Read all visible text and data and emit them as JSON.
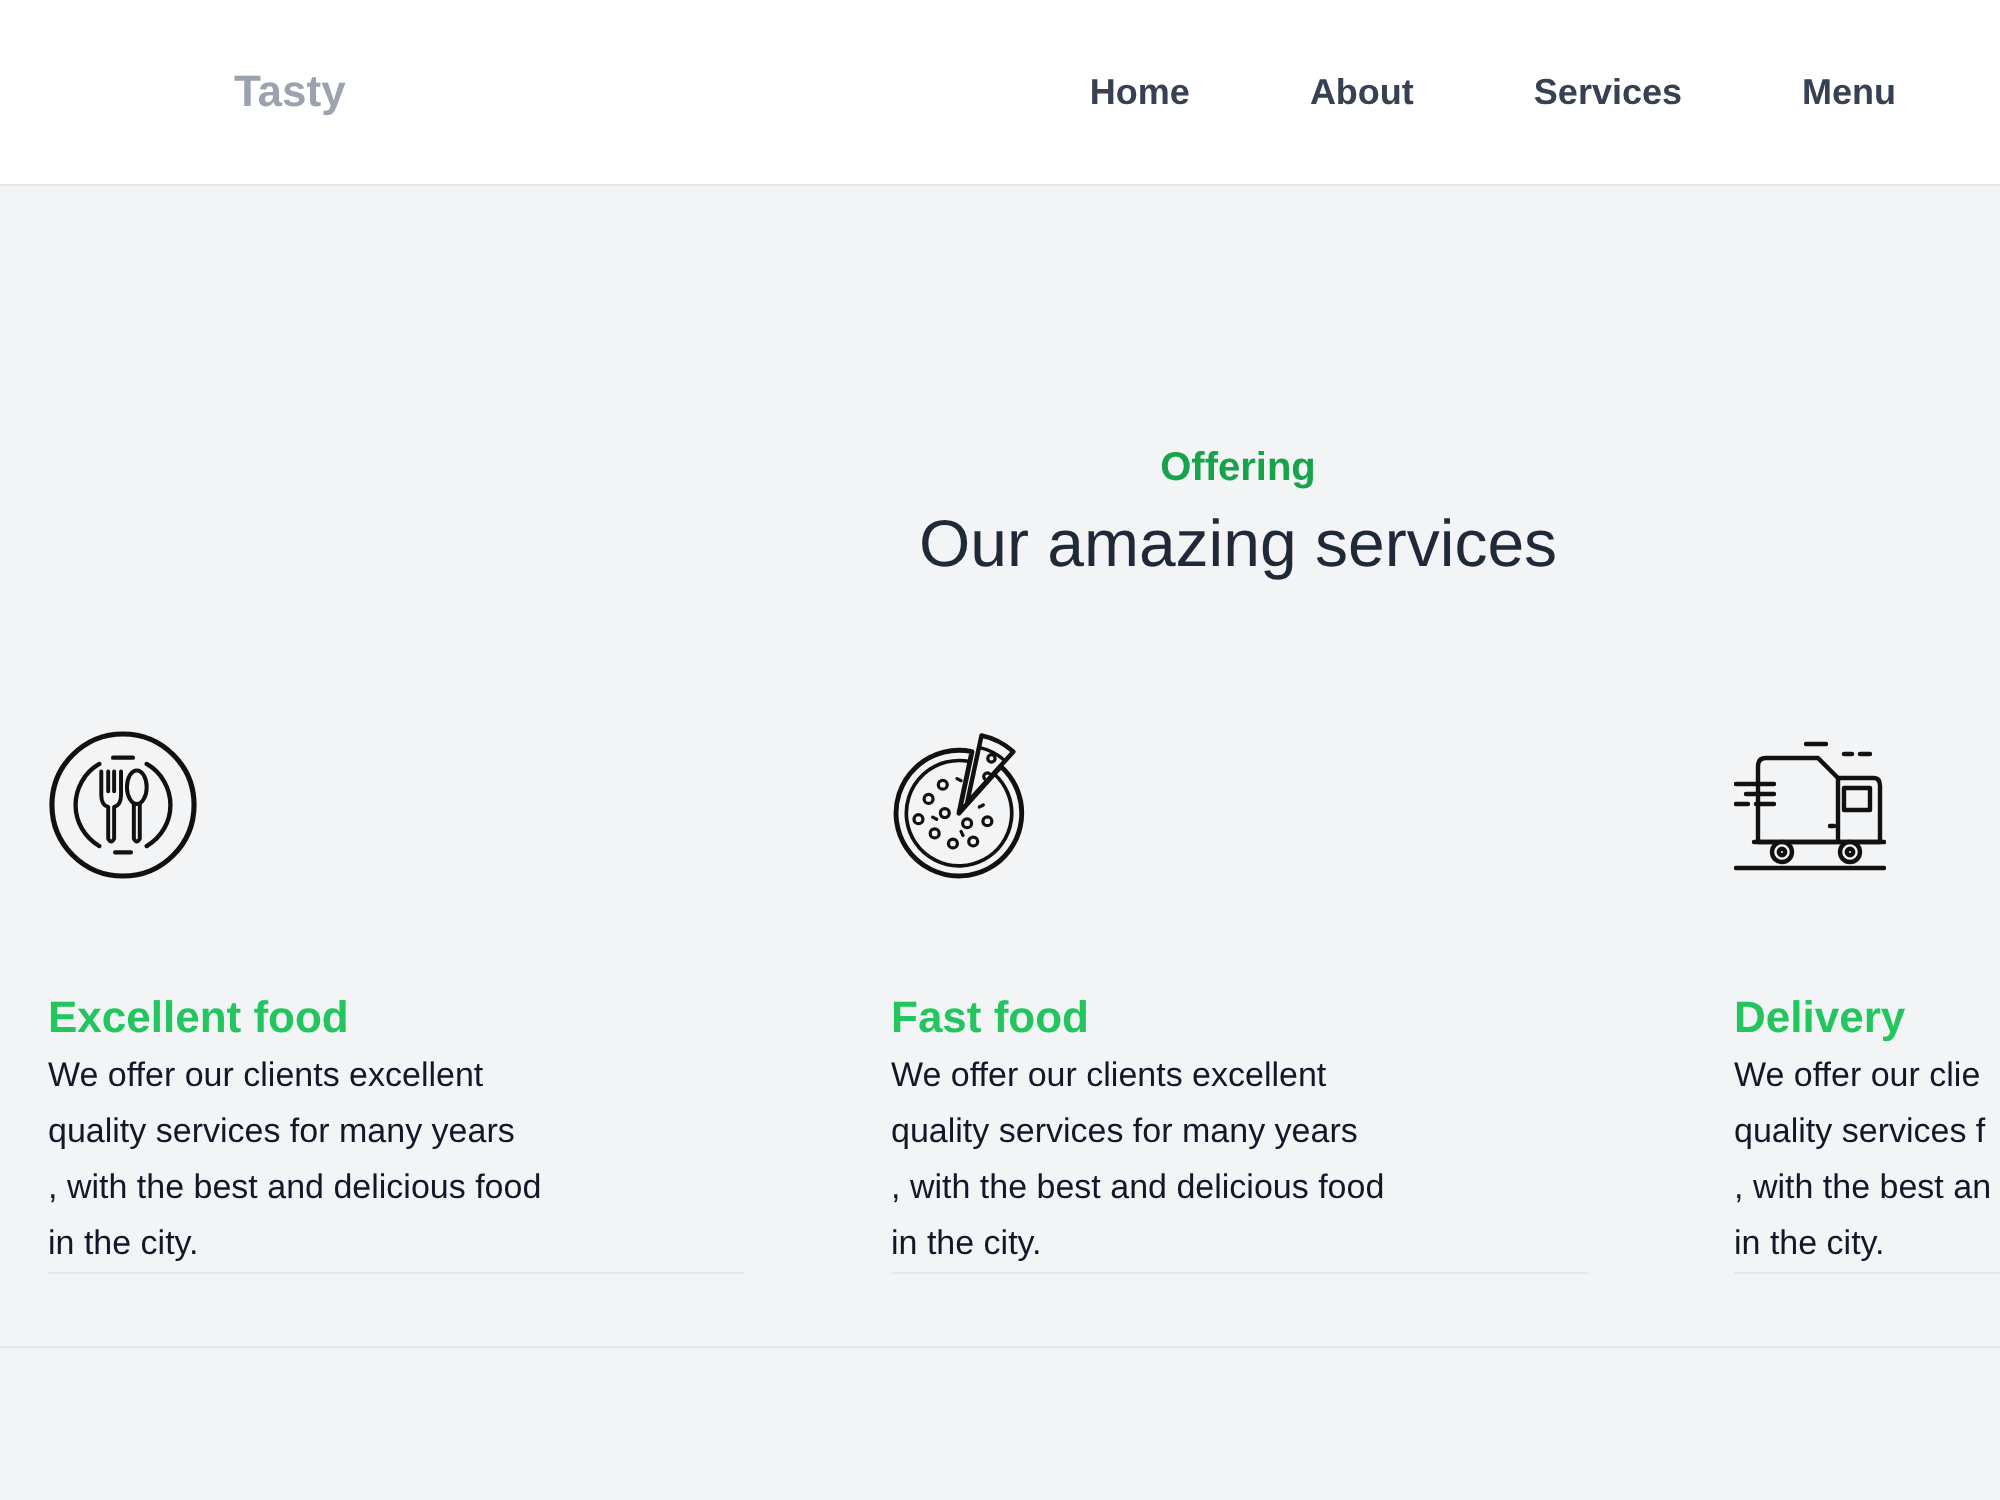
{
  "header": {
    "logo": "Tasty",
    "nav": [
      "Home",
      "About",
      "Services",
      "Menu"
    ]
  },
  "services": {
    "eyebrow": "Offering",
    "heading": "Our amazing services",
    "cards": [
      {
        "title": "Excellent food",
        "description": "We offer our clients excellent\nquality services for many years\n, with the best and delicious food\nin the city."
      },
      {
        "title": "Fast food",
        "description": "We offer our clients excellent\nquality services for many years\n, with the best and delicious food\nin the city."
      },
      {
        "title": "Delivery",
        "description": "We offer our clie\nquality services f\n, with the best an\nin the city."
      }
    ]
  }
}
